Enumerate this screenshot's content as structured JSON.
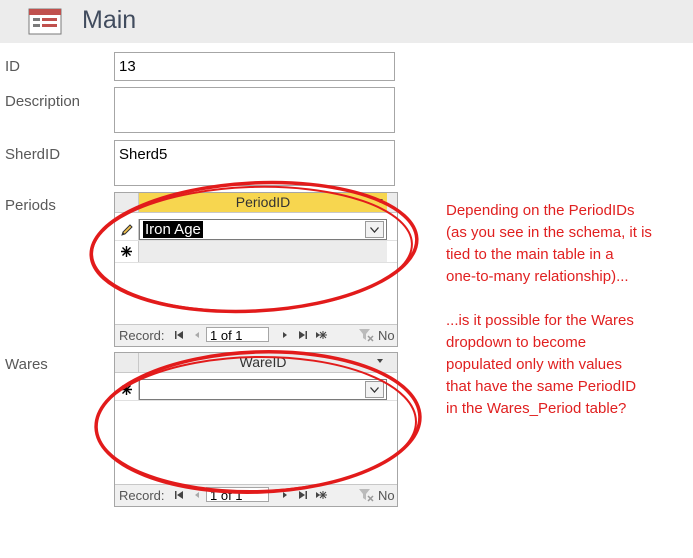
{
  "form": {
    "title": "Main",
    "icon": "form-icon"
  },
  "fields": {
    "id": {
      "label": "ID",
      "value": "13"
    },
    "description": {
      "label": "Description",
      "value": ""
    },
    "sherdid": {
      "label": "SherdID",
      "value": "Sherd5"
    }
  },
  "periods": {
    "label": "Periods",
    "column_header": "PeriodID",
    "rows": [
      {
        "selector": "pencil-icon",
        "value": "Iron Age"
      },
      {
        "selector": "new-record-icon",
        "value": ""
      }
    ],
    "navigation": {
      "record_label": "Record:",
      "current": "1 of 1",
      "filter_label": "No"
    }
  },
  "wares": {
    "label": "Wares",
    "column_header": "WareID",
    "rows": [
      {
        "selector": "new-record-icon",
        "value": ""
      }
    ],
    "navigation": {
      "record_label": "Record:",
      "current": "1 of 1",
      "filter_label": "No"
    }
  },
  "annotation": {
    "paragraph1": [
      "Depending on the PeriodIDs",
      "(as you see in the schema, it is",
      "tied to the main table in a",
      "one-to-many relationship)..."
    ],
    "paragraph2": [
      "...is it possible for the Wares",
      "dropdown to become",
      "populated only with values",
      "that have the same PeriodID",
      "in the Wares_Period table?"
    ]
  },
  "colors": {
    "annotation_red": "#e02020",
    "sorted_header": "#f7d64f",
    "title_text": "#414c5e"
  }
}
